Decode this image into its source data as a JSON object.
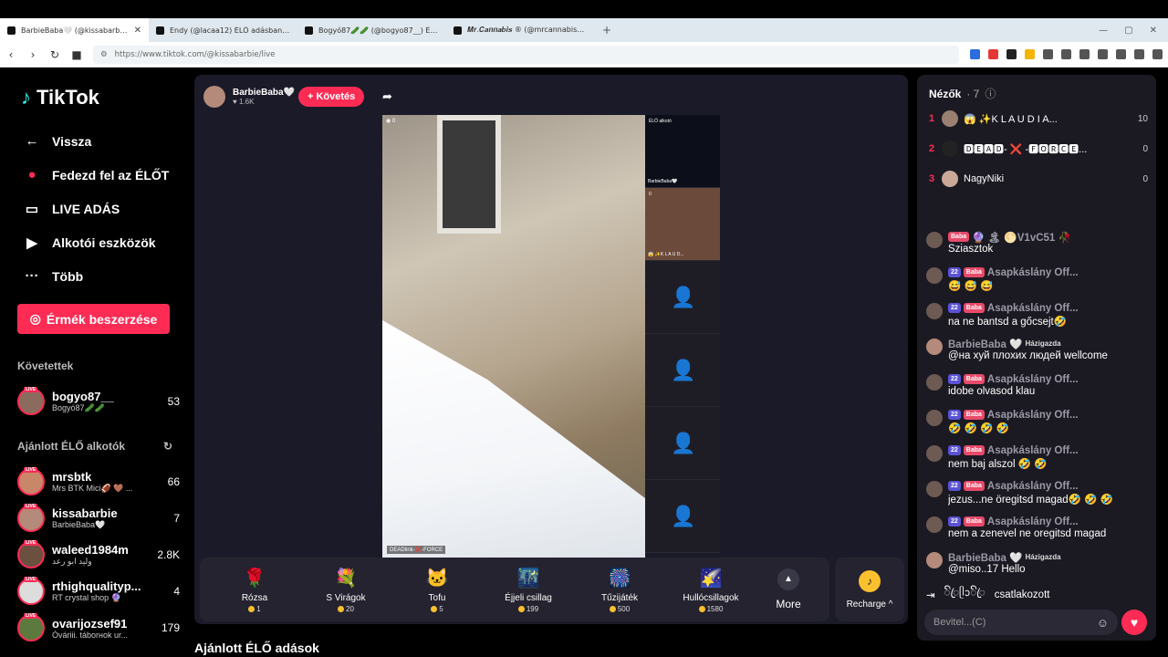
{
  "browser": {
    "tabs": [
      {
        "title": "BarbieBaba🤍 (@kissabarbie..."
      },
      {
        "title": "Endy (@lacaa12) ÉLŐ adásban van – ..."
      },
      {
        "title": "Bogyó87🥒🥒 (@bogyo87__) ÉLŐ a..."
      },
      {
        "title": "𝑴𝒓.𝑪𝒂𝒏𝒏𝒂𝒃𝒊𝒔 ® (@mrcannabis_)..."
      }
    ],
    "url": "https://www.tiktok.com/@kissabarbie/live",
    "new_tab": "+"
  },
  "sidebar": {
    "logo": "TikTok",
    "nav": [
      {
        "label": "Vissza",
        "icon": "←"
      },
      {
        "label": "Fedezd fel az ÉLŐT",
        "icon": "●"
      },
      {
        "label": "LIVE ADÁS",
        "icon": "▭"
      },
      {
        "label": "Alkotói eszközök",
        "icon": "▶"
      },
      {
        "label": "Több",
        "icon": "···"
      }
    ],
    "coins_button": "Érmék beszerzése",
    "following_title": "Követettek",
    "following": [
      {
        "name": "bogyo87__",
        "sub": "Bogyó87🥒🥒",
        "count": "53"
      }
    ],
    "recommended_title": "Ajánlott ÉLŐ alkotók",
    "recommended": [
      {
        "name": "mrsbtk",
        "sub": "Mrs BTK Mici🏈 🤎 ...",
        "count": "66"
      },
      {
        "name": "kissabarbie",
        "sub": "BarbieBaba🤍",
        "count": "7"
      },
      {
        "name": "waleed1984m",
        "sub": "وليد ابو رعد",
        "count": "2.8K"
      },
      {
        "name": "rthighqualityp...",
        "sub": "RT crystal shop 🔮",
        "count": "4"
      },
      {
        "name": "ovarijozsef91",
        "sub": "Óváriii. táborнok ur...",
        "count": "179"
      }
    ],
    "live_badge": "LIVE"
  },
  "stream": {
    "host_name": "BarbieBaba🤍",
    "host_likes": "♥ 1.6K",
    "follow_label": "+ Követés",
    "viewer_badge": "0",
    "guest_top_label": "ÉLŐ alkotó",
    "guest_top_name": "BarbieBaba🤍",
    "guest2_name": "😱 ✨K L A U D...",
    "guest2_count": "0",
    "video_tag": "DEADlink-❌-FORCE"
  },
  "gifts": [
    {
      "name": "Rózsa",
      "price": "1",
      "icon": "🌹"
    },
    {
      "name": "S Virágok",
      "price": "20",
      "icon": "💐"
    },
    {
      "name": "Tofu",
      "price": "5",
      "icon": "🐱"
    },
    {
      "name": "Éjjeli csillag",
      "price": "199",
      "icon": "🌃"
    },
    {
      "name": "Tűzijáték",
      "price": "500",
      "icon": "🎆"
    },
    {
      "name": "Hullócsillagok",
      "price": "1580",
      "icon": "🌠"
    }
  ],
  "gifts_more": "More",
  "recharge": "Recharge ^",
  "recommended_live": "Ajánlott ÉLŐ adások",
  "viewers": {
    "title": "Nézők",
    "count": "· 7",
    "list": [
      {
        "rank": "1",
        "name": "😱 ✨K L A U D I A...",
        "score": "10"
      },
      {
        "rank": "2",
        "name": "🅳🅴🅰🅳- ❌ -🅵🅾🆁🅲🅴...",
        "score": "0"
      },
      {
        "rank": "3",
        "name": "NagyNiki",
        "score": "0"
      }
    ]
  },
  "chat": [
    {
      "badges": [
        "Baba"
      ],
      "user": "🔮 🏝 🌕V1vC51 🥀",
      "tag": "",
      "text": "Sziasztok"
    },
    {
      "badges": [
        "22",
        "Baba"
      ],
      "user": "Asapkáslány Off...",
      "tag": "",
      "text": "😅 😅 😅"
    },
    {
      "badges": [
        "22",
        "Baba"
      ],
      "user": "Asapkáslány Off...",
      "tag": "",
      "text": "na ne bantsd a gőcsejt🤣"
    },
    {
      "badges": [],
      "user": "BarbieBaba 🤍",
      "tag": "Házigazda",
      "text": "@на хуй плохих людей wellcome"
    },
    {
      "badges": [
        "22",
        "Baba"
      ],
      "user": "Asapkáslány Off...",
      "tag": "",
      "text": "idobe olvasod klau"
    },
    {
      "badges": [
        "22",
        "Baba"
      ],
      "user": "Asapkáslány Off...",
      "tag": "",
      "text": "🤣 🤣 🤣 🤣"
    },
    {
      "badges": [
        "22",
        "Baba"
      ],
      "user": "Asapkáslány Off...",
      "tag": "",
      "text": "nem baj alszol 🤣 🤣"
    },
    {
      "badges": [
        "22",
        "Baba"
      ],
      "user": "Asapkáslány Off...",
      "tag": "",
      "text": "jezus...ne öregitsd magad🤣 🤣 🤣"
    },
    {
      "badges": [
        "22",
        "Baba"
      ],
      "user": "Asapkáslány Off...",
      "tag": "",
      "text": "nem a zenevel ne oregitsd magad"
    },
    {
      "badges": [],
      "user": "BarbieBaba 🤍",
      "tag": "Házigazda",
      "text": "@miso..17 Hello"
    }
  ],
  "joined": {
    "user": "ꦼꦿᥫᩣꦼꦿ",
    "text": "csatlakozott"
  },
  "input_placeholder": "Bevitel...(C)",
  "colors": {
    "accent": "#fe2c55",
    "panel": "#1b1a23"
  }
}
